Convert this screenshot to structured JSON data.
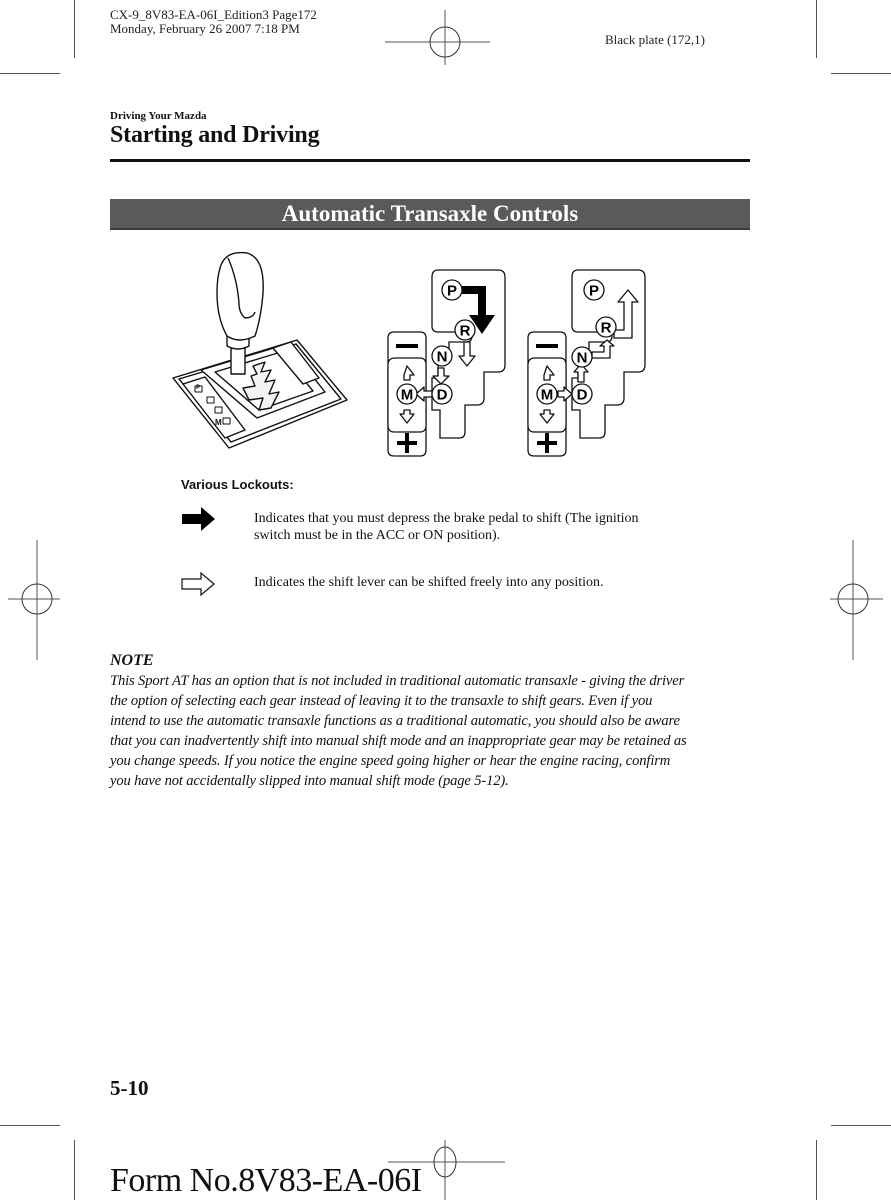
{
  "print_header": {
    "file_line": "CX-9_8V83-EA-06I_Edition3 Page172",
    "date_line": "Monday, February 26 2007 7:18 PM",
    "plate": "Black plate (172,1)"
  },
  "page": {
    "section_label": "Driving Your Mazda",
    "title": "Starting and Driving",
    "banner": "Automatic Transaxle Controls"
  },
  "figure": {
    "shift_pattern_left": {
      "gates": [
        "P",
        "R",
        "N",
        "D",
        "M"
      ],
      "minus": "−",
      "plus": "+"
    },
    "shift_pattern_right": {
      "gates": [
        "P",
        "R",
        "N",
        "D",
        "M"
      ],
      "minus": "−",
      "plus": "+"
    },
    "lever_indicator_labels": [
      "P",
      "R",
      "N",
      "D",
      "M",
      "−",
      "+"
    ]
  },
  "lockouts": {
    "heading": "Various Lockouts:",
    "items": [
      {
        "icon": "solid-arrow-icon",
        "line1": "Indicates that you must depress the brake pedal to shift (The ignition",
        "line2": "switch must be in the ACC or ON position)."
      },
      {
        "icon": "outline-arrow-icon",
        "line1": "Indicates the shift lever can be shifted freely into any position."
      }
    ]
  },
  "note": {
    "heading": "NOTE",
    "lines": [
      "This Sport AT has an option that is not included in traditional automatic transaxle - giving the driver",
      "the option of selecting each gear instead of leaving it to the transaxle to shift gears. Even if you",
      "intend to use the automatic transaxle functions as a traditional automatic, you should also be aware",
      "that you can inadvertently shift into manual shift mode and an inappropriate gear may be retained as",
      "you change speeds. If you notice the engine speed going higher or hear the engine racing, confirm",
      "you have not accidentally slipped into manual shift mode (page 5-12)."
    ]
  },
  "footer": {
    "page_number": "5-10",
    "form_number": "Form No.8V83-EA-06I"
  }
}
